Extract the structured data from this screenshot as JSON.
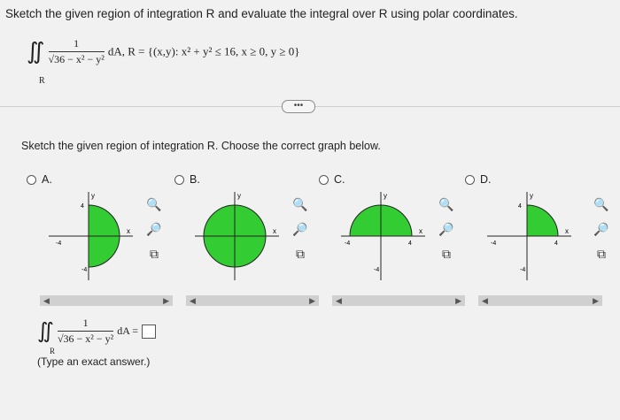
{
  "prompt": "Sketch the given region of integration R and evaluate the integral over R using polar coordinates.",
  "integral": {
    "sign": "∬",
    "sub": "R",
    "numerator": "1",
    "denominator": "√36 − x² − y²",
    "tail": "dA, R = {(x,y): x² + y² ≤ 16, x ≥ 0, y ≥ 0}"
  },
  "more_button": "•••",
  "sub_prompt": "Sketch the given region of integration R. Choose the correct graph below.",
  "options": [
    {
      "label": "A.",
      "region": "right-half"
    },
    {
      "label": "B.",
      "region": "full-disk"
    },
    {
      "label": "C.",
      "region": "upper-half"
    },
    {
      "label": "D.",
      "region": "first-quadrant"
    }
  ],
  "graph_labels": {
    "x": "x",
    "y": "y",
    "pos": "4",
    "neg": "-4"
  },
  "answer": {
    "sign": "∬",
    "sub": "R",
    "numerator": "1",
    "denominator": "√36 − x² − y²",
    "tail": "dA =",
    "hint": "(Type an exact answer.)"
  },
  "icons": [
    "zoom-in-icon",
    "zoom-out-icon",
    "popout-icon"
  ],
  "colors": {
    "region_fill": "#33cc33",
    "axis": "#222222"
  }
}
